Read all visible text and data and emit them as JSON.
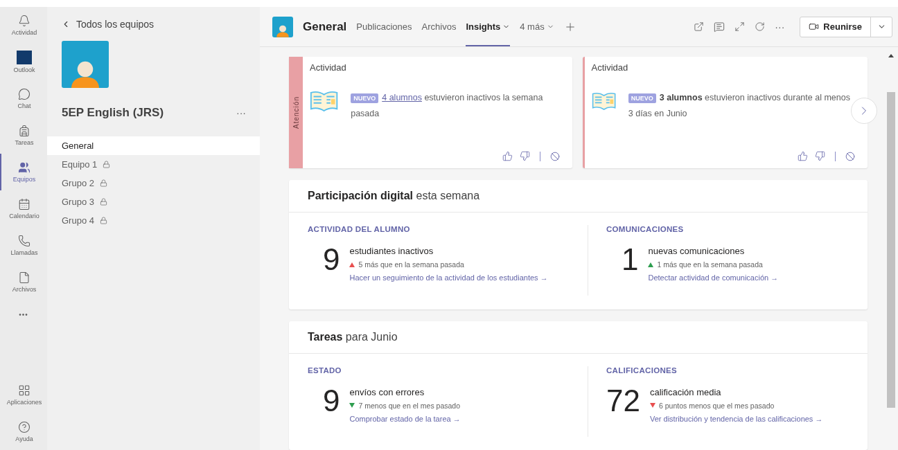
{
  "rail": {
    "items": [
      {
        "label": "Actividad",
        "selected": false
      },
      {
        "label": "Outlook",
        "selected": false
      },
      {
        "label": "Chat",
        "selected": false
      },
      {
        "label": "Tareas",
        "selected": false
      },
      {
        "label": "Equipos",
        "selected": true
      },
      {
        "label": "Calendario",
        "selected": false
      },
      {
        "label": "Llamadas",
        "selected": false
      },
      {
        "label": "Archivos",
        "selected": false
      }
    ],
    "more": "•••",
    "bottom": [
      {
        "label": "Aplicaciones",
        "selected": false
      },
      {
        "label": "Ayuda",
        "selected": false
      }
    ]
  },
  "team": {
    "back": "Todos los equipos",
    "name": "5EP English (JRS)",
    "menu": "···",
    "channels": [
      {
        "name": "General",
        "selected": true,
        "locked": false
      },
      {
        "name": "Equipo 1",
        "selected": false,
        "locked": true
      },
      {
        "name": "Grupo 2",
        "selected": false,
        "locked": true
      },
      {
        "name": "Grupo 3",
        "selected": false,
        "locked": true
      },
      {
        "name": "Grupo 4",
        "selected": false,
        "locked": true
      }
    ]
  },
  "header": {
    "title": "General",
    "tabs": [
      {
        "label": "Publicaciones",
        "selected": false,
        "dropdown": false
      },
      {
        "label": "Archivos",
        "selected": false,
        "dropdown": false
      },
      {
        "label": "Insights",
        "selected": true,
        "dropdown": true
      },
      {
        "label": "4 más",
        "selected": false,
        "dropdown": true
      }
    ],
    "more": "···",
    "meet": "Reunirse"
  },
  "insights": [
    {
      "flag": "Atención",
      "title": "Actividad",
      "badge": "NUEVO",
      "link": "4 alumnos",
      "text": "estuvieron inactivos la semana pasada"
    },
    {
      "title": "Actividad",
      "badge": "NUEVO",
      "text": "**3 alumnos** estuvieron inactivos durante al menos 3 días en Junio"
    }
  ],
  "sections": [
    {
      "title": "**Participación digital** esta semana",
      "columns": [
        {
          "heading": "ACTIVIDAD DEL ALUMNO",
          "value": "9",
          "label": "estudiantes inactivos",
          "rising": true,
          "color": "#e84f4f",
          "change": "5 más que en la semana pasada",
          "link": "Hacer un seguimiento de la actividad de los estudiantes →"
        },
        {
          "heading": "COMUNICACIONES",
          "value": "1",
          "label": "nuevas comunicaciones",
          "rising": true,
          "color": "#2e9e4f",
          "change": "1 más que en la semana pasada",
          "link": "Detectar actividad de comunicación →"
        }
      ]
    },
    {
      "title": "**Tareas** para Junio",
      "columns": [
        {
          "heading": "ESTADO",
          "value": "9",
          "label": "envíos con errores",
          "rising": false,
          "color": "#2e9e4f",
          "change": "7 menos que en el mes pasado",
          "link": "Comprobar estado de la tarea →"
        },
        {
          "heading": "CALIFICACIONES",
          "value": "72",
          "label": "calificación media",
          "rising": false,
          "color": "#e84f4f",
          "change": "6 puntos menos que el mes pasado",
          "link": "Ver distribución y tendencia de las calificaciones →"
        }
      ]
    }
  ]
}
